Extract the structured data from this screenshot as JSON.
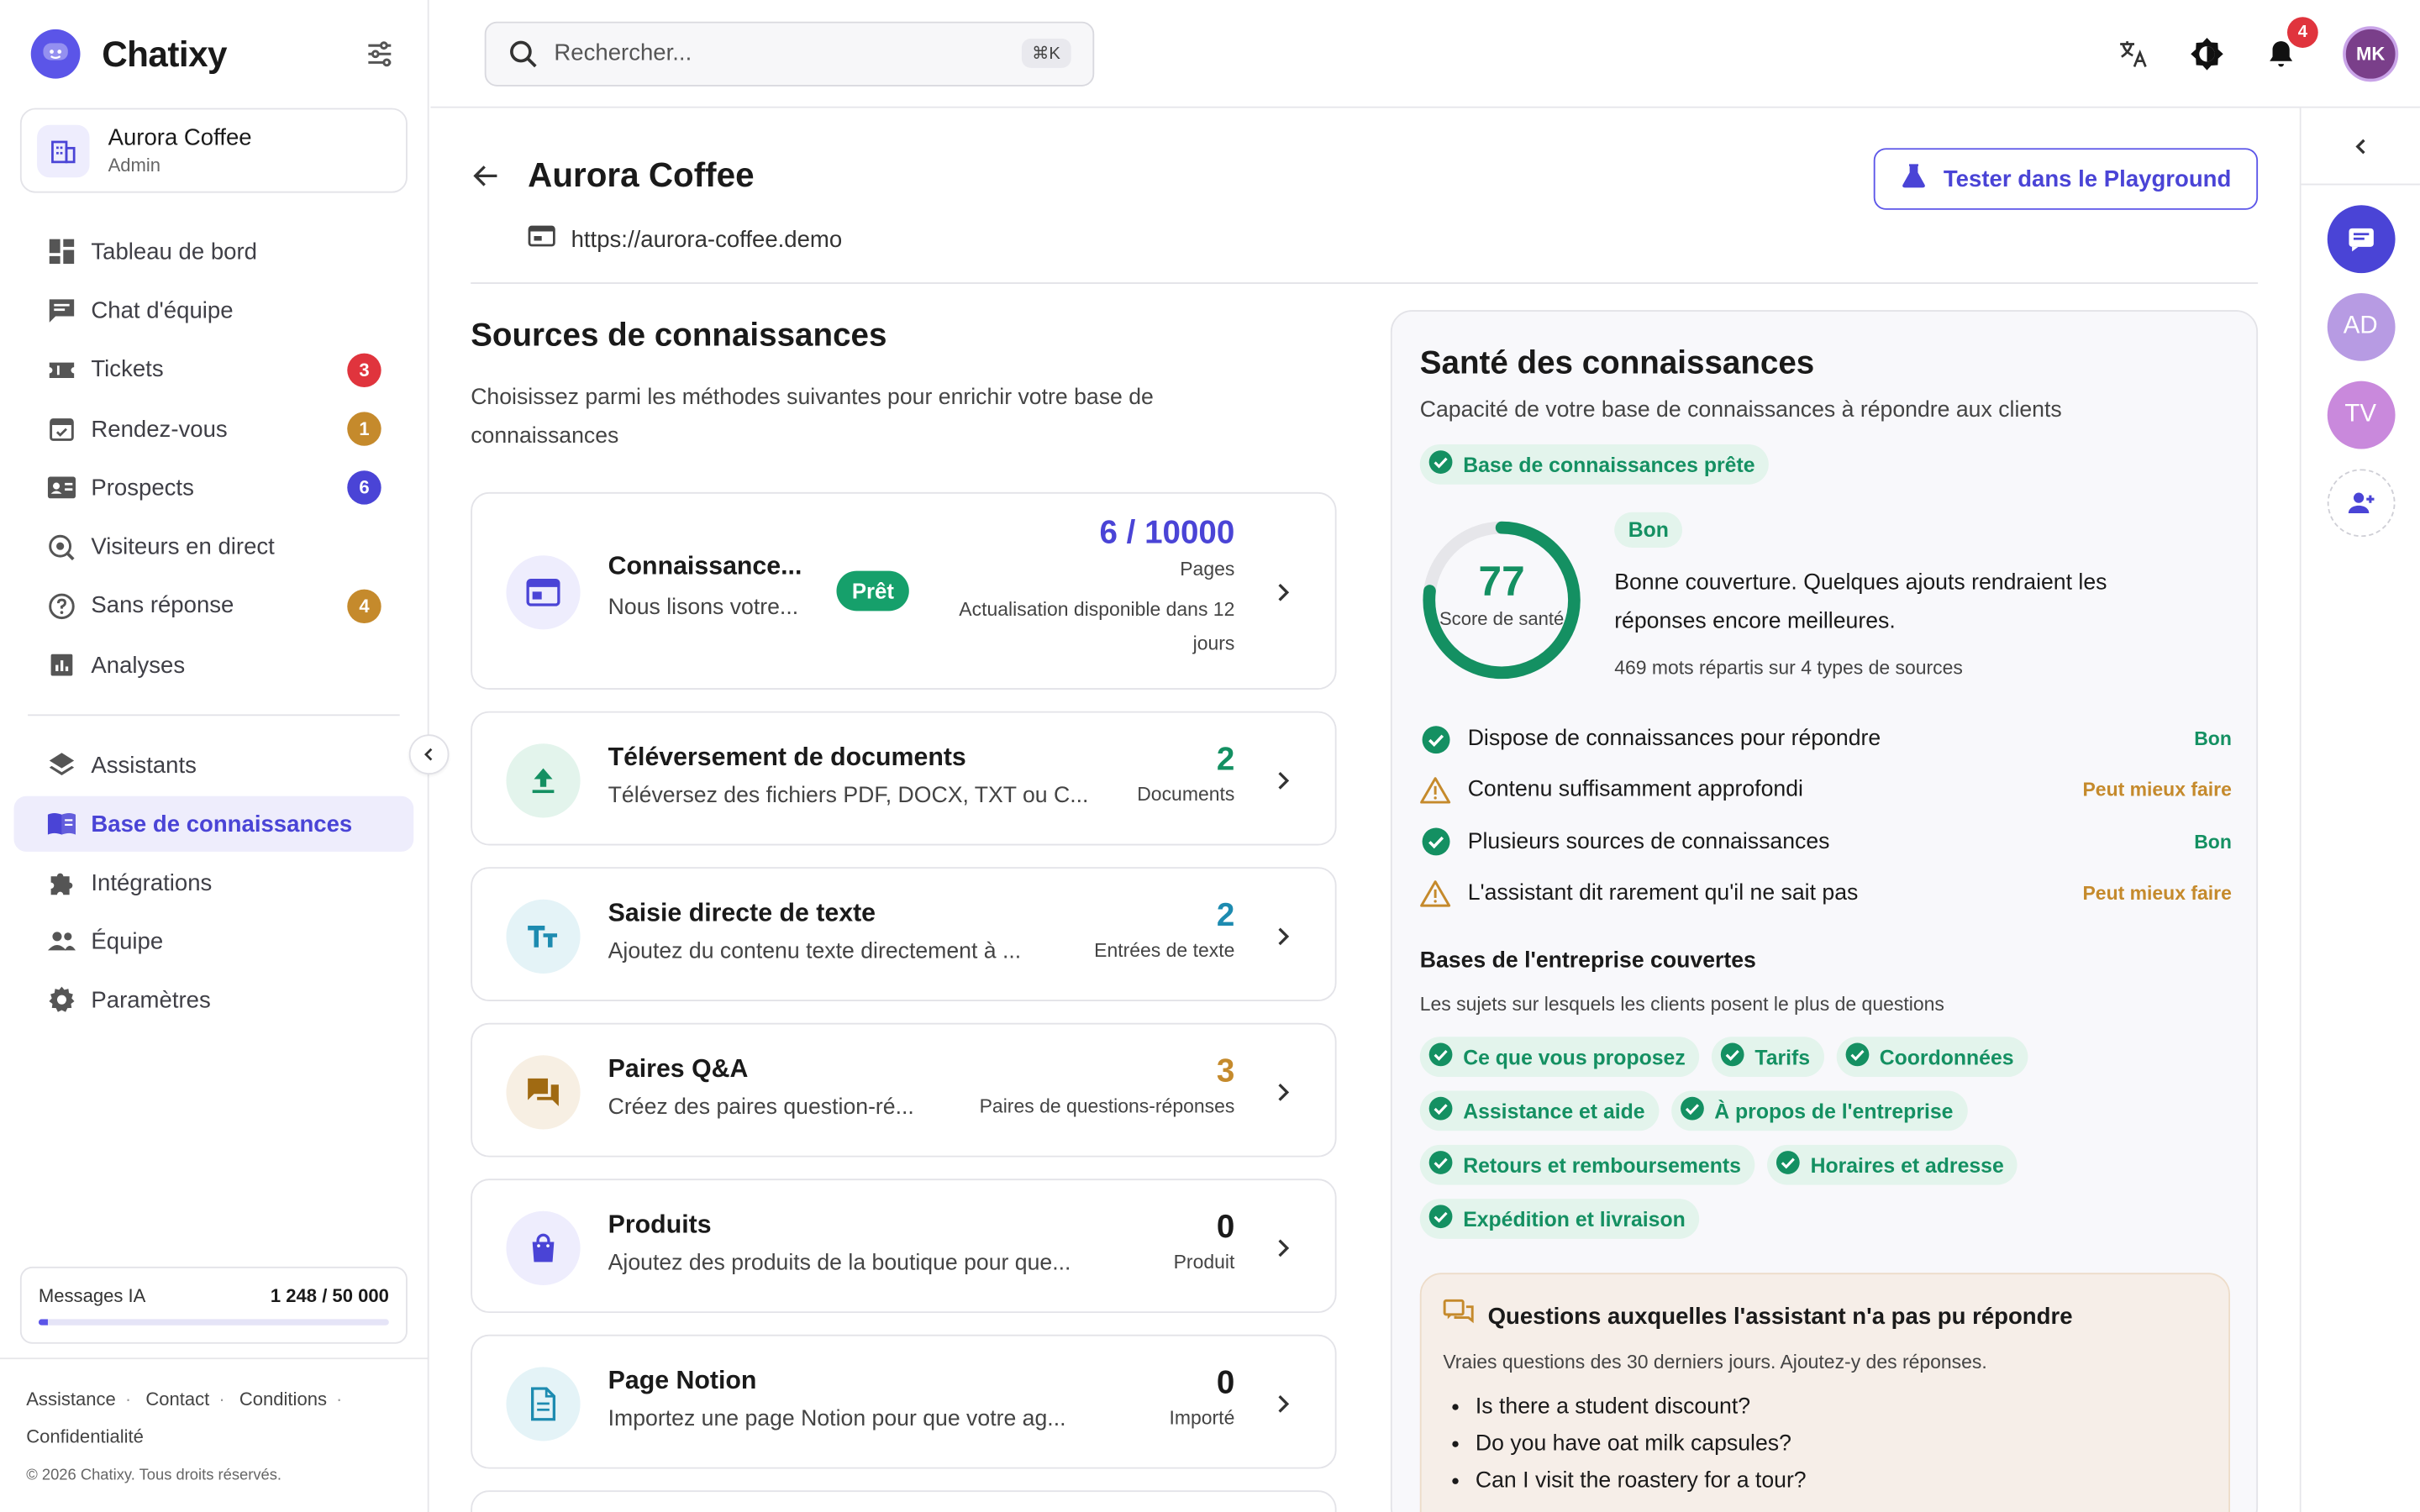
{
  "app": {
    "name": "Chatixy"
  },
  "org": {
    "name": "Aurora Coffee",
    "role": "Admin"
  },
  "nav": {
    "items": [
      {
        "label": "Tableau de bord",
        "icon": "dashboard-icon"
      },
      {
        "label": "Chat d'équipe",
        "icon": "chat-icon"
      },
      {
        "label": "Tickets",
        "icon": "ticket-icon",
        "badge": "3",
        "badge_color": "#e0343d"
      },
      {
        "label": "Rendez-vous",
        "icon": "calendar-icon",
        "badge": "1",
        "badge_color": "#c58a2c"
      },
      {
        "label": "Prospects",
        "icon": "contact-card-icon",
        "badge": "6",
        "badge_color": "#4a44d6"
      },
      {
        "label": "Visiteurs en direct",
        "icon": "live-visitors-icon"
      },
      {
        "label": "Sans réponse",
        "icon": "question-icon",
        "badge": "4",
        "badge_color": "#c58a2c"
      },
      {
        "label": "Analyses",
        "icon": "analytics-icon"
      }
    ],
    "items2": [
      {
        "label": "Assistants",
        "icon": "layers-icon"
      },
      {
        "label": "Base de connaissances",
        "icon": "book-icon",
        "active": true
      },
      {
        "label": "Intégrations",
        "icon": "puzzle-icon"
      },
      {
        "label": "Équipe",
        "icon": "team-icon"
      },
      {
        "label": "Paramètres",
        "icon": "gear-icon"
      }
    ]
  },
  "usage": {
    "label": "Messages IA",
    "value": "1 248 / 50 000",
    "fraction": 0.025
  },
  "footer": {
    "links": [
      "Assistance",
      "Contact",
      "Conditions",
      "Confidentialité"
    ],
    "copyright": "© 2026 Chatixy. Tous droits réservés."
  },
  "topbar": {
    "search_placeholder": "Rechercher...",
    "shortcut": "⌘K",
    "notifications": "4",
    "avatar": "MK"
  },
  "rail": {
    "avatars": [
      {
        "initials": "AD",
        "color": "#b79be3"
      },
      {
        "initials": "TV",
        "color": "#c989dc"
      }
    ]
  },
  "page": {
    "title": "Aurora Coffee",
    "url": "https://aurora-coffee.demo",
    "playground_label": "Tester dans le Playground"
  },
  "sources": {
    "title": "Sources de connaissances",
    "subtitle": "Choisissez parmi les méthodes suivantes pour enrichir votre base de connaissances",
    "cards": [
      {
        "title": "Connaissance...",
        "desc": "Nous lisons votre...",
        "value": "6 / 10000",
        "unit": "Pages",
        "status": "Prêt",
        "note": "Actualisation disponible dans 12 jours",
        "value_color": "#4a44d6",
        "icon": "website-icon",
        "icon_bg": "#eeedfd",
        "icon_color": "#4a44d6"
      },
      {
        "title": "Téléversement de documents",
        "desc": "Téléversez des fichiers PDF, DOCX, TXT ou C...",
        "value": "2",
        "unit": "Documents",
        "value_color": "#149062",
        "icon": "upload-icon",
        "icon_bg": "#e3f4ec",
        "icon_color": "#149062"
      },
      {
        "title": "Saisie directe de texte",
        "desc": "Ajoutez du contenu texte directement à ...",
        "value": "2",
        "unit": "Entrées de texte",
        "value_color": "#1d8bb0",
        "icon": "text-size-icon",
        "icon_bg": "#e4f3f7",
        "icon_color": "#1d8bb0"
      },
      {
        "title": "Paires Q&A",
        "desc": "Créez des paires question-ré...",
        "value": "3",
        "unit": "Paires de questions-réponses",
        "value_color": "#c58a2c",
        "icon": "forum-icon",
        "icon_bg": "#f7efe3",
        "icon_color": "#a06a12"
      },
      {
        "title": "Produits",
        "desc": "Ajoutez des produits de la boutique pour que...",
        "value": "0",
        "unit": "Produit",
        "value_color": "#1a1a1a",
        "icon": "shopping-bag-icon",
        "icon_bg": "#eeedfd",
        "icon_color": "#4a44d6"
      },
      {
        "title": "Page Notion",
        "desc": "Importez une page Notion pour que votre ag...",
        "value": "0",
        "unit": "Importé",
        "value_color": "#1a1a1a",
        "icon": "document-icon",
        "icon_bg": "#e4f3f7",
        "icon_color": "#1d8bb0"
      }
    ]
  },
  "health": {
    "title": "Santé des connaissances",
    "subtitle": "Capacité de votre base de connaissances à répondre aux clients",
    "ready": "Base de connaissances prête",
    "score": "77",
    "score_fraction": 0.77,
    "score_label": "Score de santé",
    "rating": "Bon",
    "description": "Bonne couverture. Quelques ajouts rendraient les réponses encore meilleures.",
    "meta": "469 mots répartis sur 4 types de sources",
    "checks": [
      {
        "label": "Dispose de connaissances pour répondre",
        "status": "Bon",
        "ok": true
      },
      {
        "label": "Contenu suffisamment approfondi",
        "status": "Peut mieux faire",
        "ok": false
      },
      {
        "label": "Plusieurs sources de connaissances",
        "status": "Bon",
        "ok": true
      },
      {
        "label": "L'assistant dit rarement qu'il ne sait pas",
        "status": "Peut mieux faire",
        "ok": false
      }
    ],
    "topics_title": "Bases de l'entreprise couvertes",
    "topics_sub": "Les sujets sur lesquels les clients posent le plus de questions",
    "topics": [
      "Ce que vous proposez",
      "Tarifs",
      "Coordonnées",
      "Assistance et aide",
      "À propos de l'entreprise",
      "Retours et remboursements",
      "Horaires et adresse",
      "Expédition et livraison"
    ],
    "unanswered_title": "Questions auxquelles l'assistant n'a pas pu répondre",
    "unanswered_sub": "Vraies questions des 30 derniers jours. Ajoutez-y des réponses.",
    "unanswered": [
      "Is there a student discount?",
      "Do you have oat milk capsules?",
      "Can I visit the roastery for a tour?"
    ]
  },
  "colors": {
    "brand": "#5b55e8",
    "green": "#149062",
    "warn": "#c58a2c"
  }
}
